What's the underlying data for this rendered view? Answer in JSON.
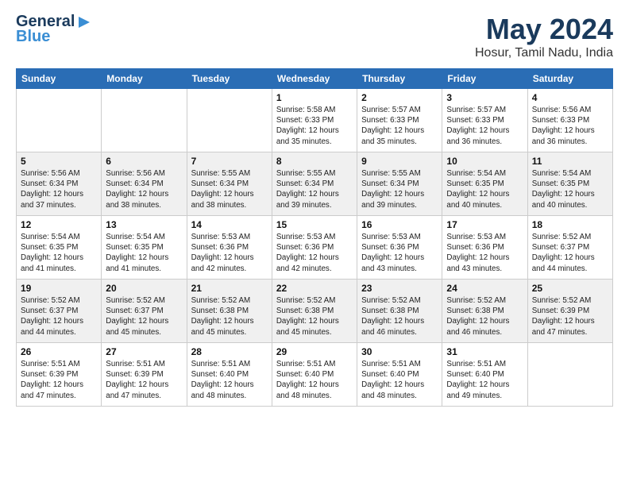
{
  "header": {
    "logo_general": "General",
    "logo_blue": "Blue",
    "title": "May 2024",
    "location": "Hosur, Tamil Nadu, India"
  },
  "days_of_week": [
    "Sunday",
    "Monday",
    "Tuesday",
    "Wednesday",
    "Thursday",
    "Friday",
    "Saturday"
  ],
  "weeks": [
    {
      "shaded": false,
      "days": [
        {
          "num": "",
          "info": ""
        },
        {
          "num": "",
          "info": ""
        },
        {
          "num": "",
          "info": ""
        },
        {
          "num": "1",
          "info": "Sunrise: 5:58 AM\nSunset: 6:33 PM\nDaylight: 12 hours\nand 35 minutes."
        },
        {
          "num": "2",
          "info": "Sunrise: 5:57 AM\nSunset: 6:33 PM\nDaylight: 12 hours\nand 35 minutes."
        },
        {
          "num": "3",
          "info": "Sunrise: 5:57 AM\nSunset: 6:33 PM\nDaylight: 12 hours\nand 36 minutes."
        },
        {
          "num": "4",
          "info": "Sunrise: 5:56 AM\nSunset: 6:33 PM\nDaylight: 12 hours\nand 36 minutes."
        }
      ]
    },
    {
      "shaded": true,
      "days": [
        {
          "num": "5",
          "info": "Sunrise: 5:56 AM\nSunset: 6:34 PM\nDaylight: 12 hours\nand 37 minutes."
        },
        {
          "num": "6",
          "info": "Sunrise: 5:56 AM\nSunset: 6:34 PM\nDaylight: 12 hours\nand 38 minutes."
        },
        {
          "num": "7",
          "info": "Sunrise: 5:55 AM\nSunset: 6:34 PM\nDaylight: 12 hours\nand 38 minutes."
        },
        {
          "num": "8",
          "info": "Sunrise: 5:55 AM\nSunset: 6:34 PM\nDaylight: 12 hours\nand 39 minutes."
        },
        {
          "num": "9",
          "info": "Sunrise: 5:55 AM\nSunset: 6:34 PM\nDaylight: 12 hours\nand 39 minutes."
        },
        {
          "num": "10",
          "info": "Sunrise: 5:54 AM\nSunset: 6:35 PM\nDaylight: 12 hours\nand 40 minutes."
        },
        {
          "num": "11",
          "info": "Sunrise: 5:54 AM\nSunset: 6:35 PM\nDaylight: 12 hours\nand 40 minutes."
        }
      ]
    },
    {
      "shaded": false,
      "days": [
        {
          "num": "12",
          "info": "Sunrise: 5:54 AM\nSunset: 6:35 PM\nDaylight: 12 hours\nand 41 minutes."
        },
        {
          "num": "13",
          "info": "Sunrise: 5:54 AM\nSunset: 6:35 PM\nDaylight: 12 hours\nand 41 minutes."
        },
        {
          "num": "14",
          "info": "Sunrise: 5:53 AM\nSunset: 6:36 PM\nDaylight: 12 hours\nand 42 minutes."
        },
        {
          "num": "15",
          "info": "Sunrise: 5:53 AM\nSunset: 6:36 PM\nDaylight: 12 hours\nand 42 minutes."
        },
        {
          "num": "16",
          "info": "Sunrise: 5:53 AM\nSunset: 6:36 PM\nDaylight: 12 hours\nand 43 minutes."
        },
        {
          "num": "17",
          "info": "Sunrise: 5:53 AM\nSunset: 6:36 PM\nDaylight: 12 hours\nand 43 minutes."
        },
        {
          "num": "18",
          "info": "Sunrise: 5:52 AM\nSunset: 6:37 PM\nDaylight: 12 hours\nand 44 minutes."
        }
      ]
    },
    {
      "shaded": true,
      "days": [
        {
          "num": "19",
          "info": "Sunrise: 5:52 AM\nSunset: 6:37 PM\nDaylight: 12 hours\nand 44 minutes."
        },
        {
          "num": "20",
          "info": "Sunrise: 5:52 AM\nSunset: 6:37 PM\nDaylight: 12 hours\nand 45 minutes."
        },
        {
          "num": "21",
          "info": "Sunrise: 5:52 AM\nSunset: 6:38 PM\nDaylight: 12 hours\nand 45 minutes."
        },
        {
          "num": "22",
          "info": "Sunrise: 5:52 AM\nSunset: 6:38 PM\nDaylight: 12 hours\nand 45 minutes."
        },
        {
          "num": "23",
          "info": "Sunrise: 5:52 AM\nSunset: 6:38 PM\nDaylight: 12 hours\nand 46 minutes."
        },
        {
          "num": "24",
          "info": "Sunrise: 5:52 AM\nSunset: 6:38 PM\nDaylight: 12 hours\nand 46 minutes."
        },
        {
          "num": "25",
          "info": "Sunrise: 5:52 AM\nSunset: 6:39 PM\nDaylight: 12 hours\nand 47 minutes."
        }
      ]
    },
    {
      "shaded": false,
      "days": [
        {
          "num": "26",
          "info": "Sunrise: 5:51 AM\nSunset: 6:39 PM\nDaylight: 12 hours\nand 47 minutes."
        },
        {
          "num": "27",
          "info": "Sunrise: 5:51 AM\nSunset: 6:39 PM\nDaylight: 12 hours\nand 47 minutes."
        },
        {
          "num": "28",
          "info": "Sunrise: 5:51 AM\nSunset: 6:40 PM\nDaylight: 12 hours\nand 48 minutes."
        },
        {
          "num": "29",
          "info": "Sunrise: 5:51 AM\nSunset: 6:40 PM\nDaylight: 12 hours\nand 48 minutes."
        },
        {
          "num": "30",
          "info": "Sunrise: 5:51 AM\nSunset: 6:40 PM\nDaylight: 12 hours\nand 48 minutes."
        },
        {
          "num": "31",
          "info": "Sunrise: 5:51 AM\nSunset: 6:40 PM\nDaylight: 12 hours\nand 49 minutes."
        },
        {
          "num": "",
          "info": ""
        }
      ]
    }
  ]
}
